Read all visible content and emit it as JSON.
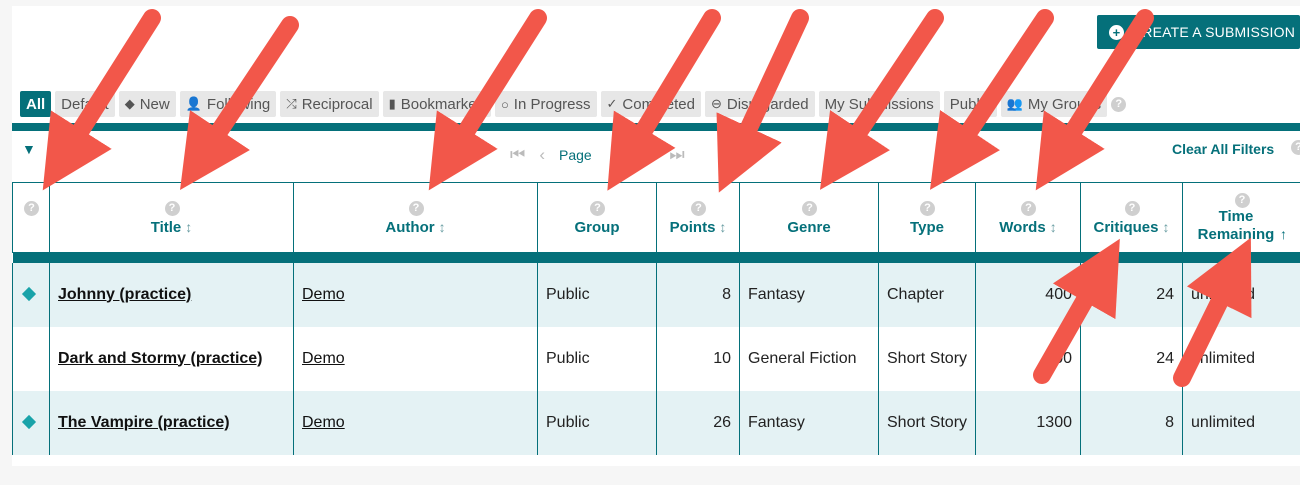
{
  "header": {
    "create_button_label": "CREATE A SUBMISSION"
  },
  "filters": [
    {
      "label": "All",
      "icon": "",
      "active": true
    },
    {
      "label": "Default",
      "icon": ""
    },
    {
      "label": "New",
      "icon": "diamond-icon"
    },
    {
      "label": "Following",
      "icon": "person-icon"
    },
    {
      "label": "Reciprocal",
      "icon": "shuffle-icon"
    },
    {
      "label": "Bookmarked",
      "icon": "bookmark-icon"
    },
    {
      "label": "In Progress",
      "icon": "circle-icon"
    },
    {
      "label": "Completed",
      "icon": "check-icon"
    },
    {
      "label": "Disregarded",
      "icon": "minus-circle-icon"
    },
    {
      "label": "My Submissions",
      "icon": ""
    },
    {
      "label": "Public",
      "icon": ""
    },
    {
      "label": "My Groups",
      "icon": "group-icon"
    }
  ],
  "pager": {
    "page_label": "Page",
    "clear_filters_label": "Clear All Filters"
  },
  "columns": {
    "title": "Title",
    "author": "Author",
    "group": "Group",
    "points": "Points",
    "genre": "Genre",
    "type": "Type",
    "words": "Words",
    "critiques": "Critiques",
    "time_remaining": "Time Remaining"
  },
  "rows": [
    {
      "new": true,
      "title": "Johnny (practice)",
      "author": "Demo",
      "group": "Public",
      "points": "8",
      "genre": "Fantasy",
      "type": "Chapter",
      "words": "400",
      "critiques": "24",
      "time_remaining": "unlimited"
    },
    {
      "new": false,
      "title": "Dark and Stormy (practice)",
      "author": "Demo",
      "group": "Public",
      "points": "10",
      "genre": "General Fiction",
      "type": "Short Story",
      "words": "500",
      "critiques": "24",
      "time_remaining": "unlimited"
    },
    {
      "new": true,
      "title": "The Vampire (practice)",
      "author": "Demo",
      "group": "Public",
      "points": "26",
      "genre": "Fantasy",
      "type": "Short Story",
      "words": "1300",
      "critiques": "8",
      "time_remaining": "unlimited"
    }
  ],
  "colors": {
    "accent": "#05707a",
    "arrow": "#f2574a",
    "row_shade": "#e4f2f4"
  }
}
